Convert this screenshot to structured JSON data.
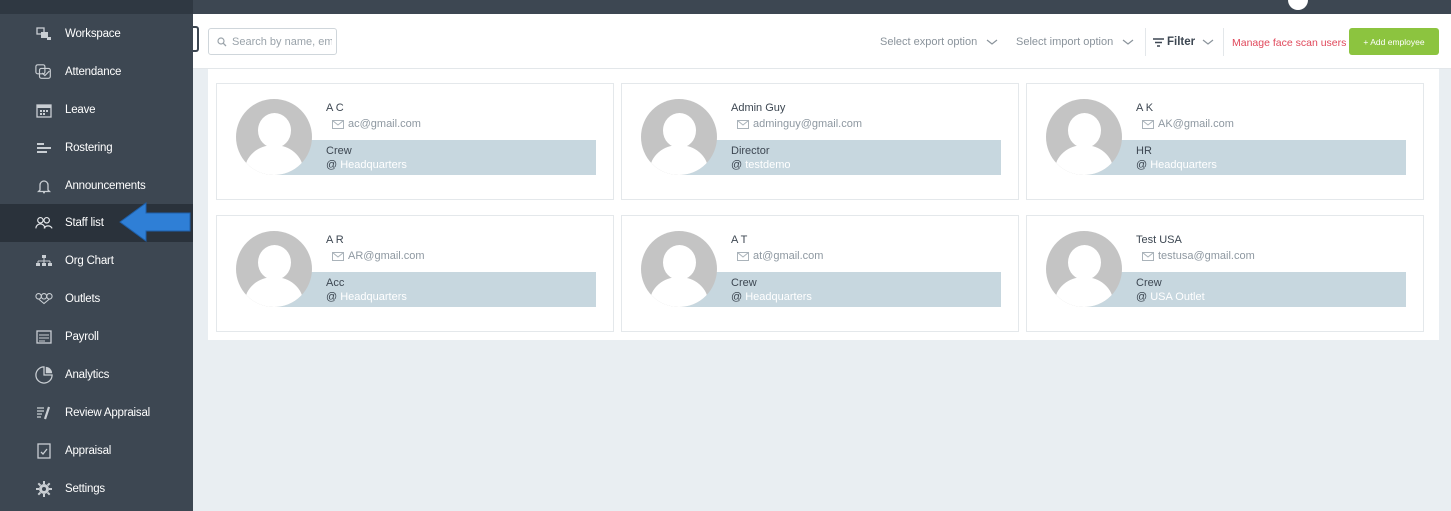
{
  "sidebar": {
    "items": [
      {
        "label": "Workspace",
        "icon": "workspace-icon"
      },
      {
        "label": "Attendance",
        "icon": "attendance-icon"
      },
      {
        "label": "Leave",
        "icon": "leave-calendar-icon"
      },
      {
        "label": "Rostering",
        "icon": "rostering-icon"
      },
      {
        "label": "Announcements",
        "icon": "bell-icon"
      },
      {
        "label": "Staff list",
        "icon": "people-icon",
        "active": true
      },
      {
        "label": "Org Chart",
        "icon": "org-chart-icon"
      },
      {
        "label": "Outlets",
        "icon": "outlets-icon"
      },
      {
        "label": "Payroll",
        "icon": "payroll-icon"
      },
      {
        "label": "Analytics",
        "icon": "analytics-icon"
      },
      {
        "label": "Review Appraisal",
        "icon": "review-appraisal-icon"
      },
      {
        "label": "Appraisal",
        "icon": "appraisal-icon"
      },
      {
        "label": "Settings",
        "icon": "gear-icon"
      }
    ]
  },
  "toolbar": {
    "search_placeholder": "Search by name, em",
    "export_label": "Select export option",
    "import_label": "Select import option",
    "filter_label": "Filter",
    "manage_label": "Manage face scan users",
    "add_label": "+ Add employee"
  },
  "employees": [
    {
      "name": "A C",
      "email": "ac@gmail.com",
      "role": "Crew",
      "location": "Headquarters"
    },
    {
      "name": "Admin Guy",
      "email": "adminguy@gmail.com",
      "role": "Director",
      "location": "testdemo"
    },
    {
      "name": "A K",
      "email": "AK@gmail.com",
      "role": "HR",
      "location": "Headquarters"
    },
    {
      "name": "A R",
      "email": "AR@gmail.com",
      "role": "Acc",
      "location": "Headquarters"
    },
    {
      "name": "A T",
      "email": "at@gmail.com",
      "role": "Crew",
      "location": "Headquarters"
    },
    {
      "name": "Test USA",
      "email": "testusa@gmail.com",
      "role": "Crew",
      "location": "USA Outlet"
    }
  ],
  "at_symbol": "@",
  "colors": {
    "sidebar_bg": "#3d4752",
    "accent_green": "#8cc43f",
    "manage_red": "#e0485b",
    "role_box": "#c7d7df",
    "arrow_blue": "#2f7fd6"
  }
}
